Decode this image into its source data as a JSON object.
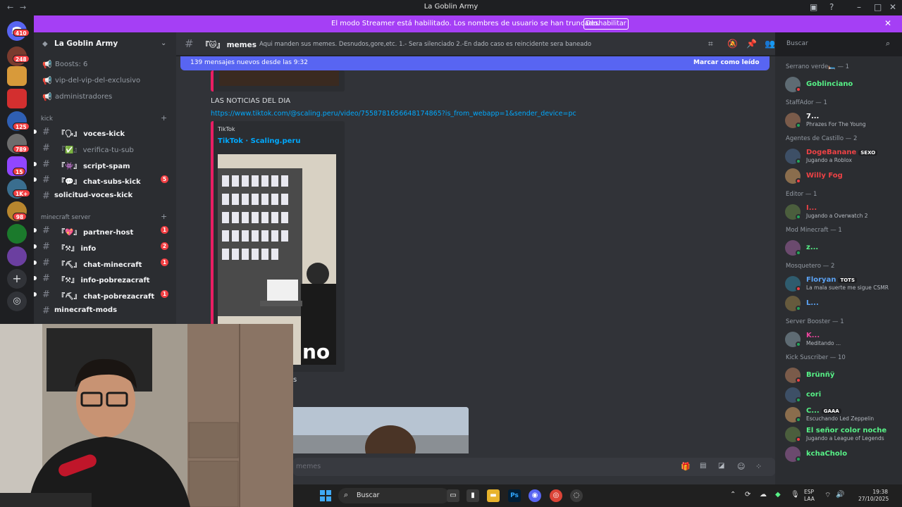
{
  "window": {
    "title": "La Goblin Army"
  },
  "banner": {
    "text": "El modo Streamer está habilitado. Los nombres de usuario se han truncado.",
    "button": "Deshabilitar"
  },
  "rail": {
    "badges": [
      "410",
      "248",
      "125",
      "789",
      "15",
      "1K+",
      "98"
    ]
  },
  "sidebar": {
    "server_name": "La Goblin Army",
    "top_items": [
      {
        "label": "Boosts: 6"
      },
      {
        "label": "vip-del-vip-del-exclusivo"
      },
      {
        "label": "administradores"
      }
    ],
    "categories": [
      {
        "name": "kick"
      },
      {
        "name": "minecraft server"
      }
    ],
    "channels": [
      {
        "prefix": "『🗣』",
        "label": "voces-kick",
        "count": ""
      },
      {
        "prefix": "『✅』",
        "label": "verifica-tu-sub",
        "count": ""
      },
      {
        "prefix": "『👾』",
        "label": "script-spam",
        "count": ""
      },
      {
        "prefix": "『💬』",
        "label": "chat-subs-kick",
        "count": "5"
      },
      {
        "prefix": "",
        "label": "solicitud-voces-kick",
        "count": ""
      },
      {
        "prefix": "『💖』",
        "label": "partner-host",
        "count": "1"
      },
      {
        "prefix": "『⚒』",
        "label": "info",
        "count": "2"
      },
      {
        "prefix": "『⛏』",
        "label": "chat-minecraft",
        "count": "1"
      },
      {
        "prefix": "『⚒』",
        "label": "info-pobrezacraft",
        "count": ""
      },
      {
        "prefix": "『⛏』",
        "label": "chat-pobrezacraft",
        "count": "1"
      },
      {
        "prefix": "",
        "label": "minecraft-mods",
        "count": ""
      }
    ]
  },
  "header": {
    "channel_prefix": "『🐱』",
    "channel": "memes",
    "topic": "Aqui manden sus memes. Desnudos,gore,etc. 1.- Sera silenciado 2.-En dado caso es reincidente sera baneado",
    "search_placeholder": "Buscar"
  },
  "chat": {
    "new_messages": "139 mensajes nuevos desde las 9:32",
    "mark_read": "Marcar como leído",
    "message_text": "LAS NOTICIAS DEL DIA",
    "link": "https://www.tiktok.com/@scaling.peru/video/7558781656648174865?is_from_webapp=1&sender_device=pc",
    "embed_provider": "TikTok",
    "embed_title": "TikTok · Scaling.peru",
    "overlay_text": "no",
    "fragment": "s",
    "composer_placeholder": "memes"
  },
  "members": {
    "groups": [
      {
        "header": "Serrano verde🛏️ — 1",
        "members": [
          {
            "name": "Goblinciano",
            "sub": "",
            "color": "#57f287",
            "tag": ""
          }
        ]
      },
      {
        "header": "StaffAdor — 1",
        "members": [
          {
            "name": "7...",
            "sub": "Phrazes For The Young",
            "color": "#ffffff",
            "tag": ""
          }
        ]
      },
      {
        "header": "Agentes de Castillo — 2",
        "members": [
          {
            "name": "DogeBanane",
            "sub": "Jugando a Roblox",
            "color": "#ed4245",
            "tag": "SEXO"
          },
          {
            "name": "Willy Fog",
            "sub": "",
            "color": "#ed4245",
            "tag": ""
          }
        ]
      },
      {
        "header": "Editor — 1",
        "members": [
          {
            "name": "I...",
            "sub": "Jugando a Overwatch 2",
            "color": "#ed4245",
            "tag": ""
          }
        ]
      },
      {
        "header": "Mod Minecraft — 1",
        "members": [
          {
            "name": "z...",
            "sub": "",
            "color": "#57f287",
            "tag": ""
          }
        ]
      },
      {
        "header": "Mosquetero — 2",
        "members": [
          {
            "name": "Floryan",
            "sub": "La mala suerte me sigue CSMR",
            "color": "#5ba3f5",
            "tag": "TOTS"
          },
          {
            "name": "L...",
            "sub": "",
            "color": "#5ba3f5",
            "tag": ""
          }
        ]
      },
      {
        "header": "Server Booster — 1",
        "members": [
          {
            "name": "K...",
            "sub": "Meditando ...",
            "color": "#eb459e",
            "tag": ""
          }
        ]
      },
      {
        "header": "Kick Suscriber — 10",
        "members": [
          {
            "name": "Brünñÿ",
            "sub": "",
            "color": "#57f287",
            "tag": ""
          },
          {
            "name": "cori",
            "sub": "",
            "color": "#57f287",
            "tag": ""
          },
          {
            "name": "C...",
            "sub": "Escuchando Led Zeppelin",
            "color": "#57f287",
            "tag": "GAAA"
          },
          {
            "name": "El señor color noche",
            "sub": "Jugando a League of Legends",
            "color": "#57f287",
            "tag": ""
          },
          {
            "name": "kchaCholo",
            "sub": "",
            "color": "#57f287",
            "tag": ""
          }
        ]
      }
    ]
  },
  "taskbar": {
    "search": "Buscar",
    "lang": "ESP",
    "lang2": "LAA",
    "time": "19:38",
    "date": "27/10/2025"
  },
  "colors": {
    "accent": "#5865f2",
    "streamer": "#a53ff5",
    "mention": "#f23f43"
  }
}
